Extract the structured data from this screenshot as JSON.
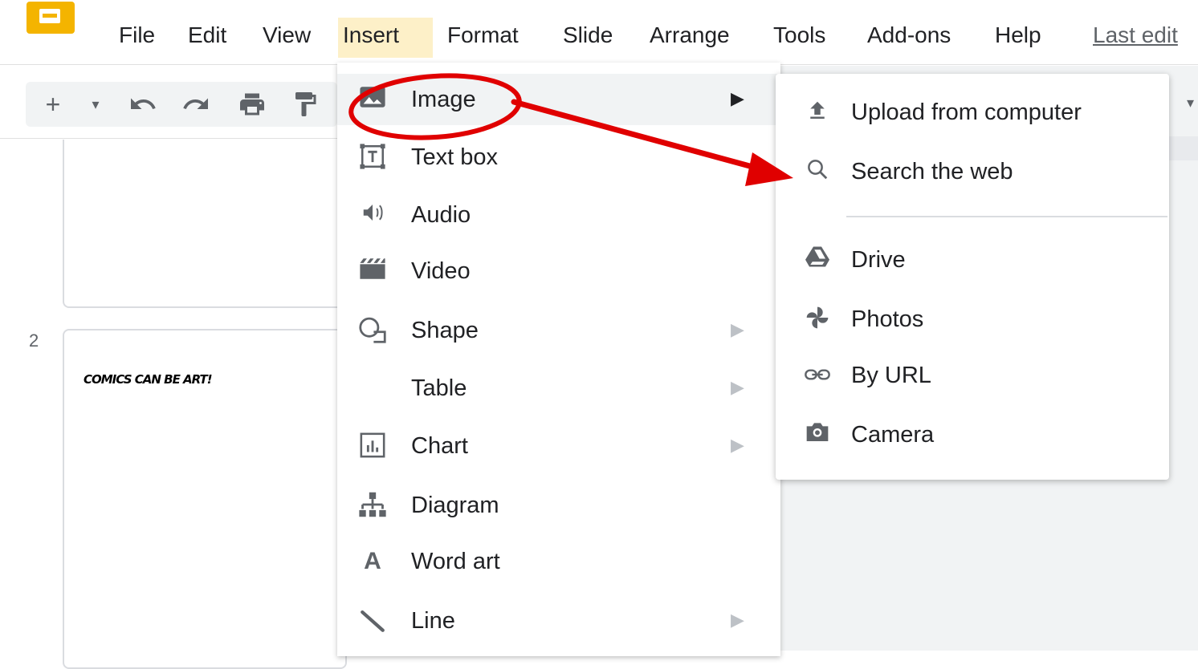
{
  "menubar": {
    "items": [
      "File",
      "Edit",
      "View",
      "Insert",
      "Format",
      "Slide",
      "Arrange",
      "Tools",
      "Add-ons",
      "Help"
    ],
    "active": "Insert",
    "last_edit": "Last edit"
  },
  "toolbar": {
    "icons": [
      "plus-icon",
      "dropdown-caret-icon",
      "undo-icon",
      "redo-icon",
      "print-icon",
      "paint-format-icon"
    ]
  },
  "filmstrip": {
    "slide2": {
      "number": "2",
      "title": "COMICS CAN BE ART!"
    }
  },
  "insert_menu": {
    "items": [
      {
        "label": "Image",
        "icon": "image-icon",
        "submenu": true
      },
      {
        "label": "Text box",
        "icon": "text-box-icon",
        "submenu": false
      },
      {
        "label": "Audio",
        "icon": "audio-icon",
        "submenu": false
      },
      {
        "label": "Video",
        "icon": "video-icon",
        "submenu": false
      },
      {
        "label": "Shape",
        "icon": "shape-icon",
        "submenu": true
      },
      {
        "label": "Table",
        "icon": "",
        "submenu": true
      },
      {
        "label": "Chart",
        "icon": "chart-icon",
        "submenu": true
      },
      {
        "label": "Diagram",
        "icon": "diagram-icon",
        "submenu": false
      },
      {
        "label": "Word art",
        "icon": "word-art-icon",
        "submenu": false
      },
      {
        "label": "Line",
        "icon": "line-icon",
        "submenu": true
      }
    ]
  },
  "image_submenu": {
    "items": [
      {
        "label": "Upload from computer",
        "icon": "upload-icon"
      },
      {
        "label": "Search the web",
        "icon": "search-icon"
      },
      {
        "label": "Drive",
        "icon": "drive-icon"
      },
      {
        "label": "Photos",
        "icon": "photos-icon"
      },
      {
        "label": "By URL",
        "icon": "link-icon"
      },
      {
        "label": "Camera",
        "icon": "camera-icon"
      }
    ]
  },
  "annotation": {
    "color": "#e00000"
  },
  "colors": {
    "brand": "#F4B400",
    "menu_active": "#fdf0c8",
    "hover": "#f1f3f4"
  }
}
